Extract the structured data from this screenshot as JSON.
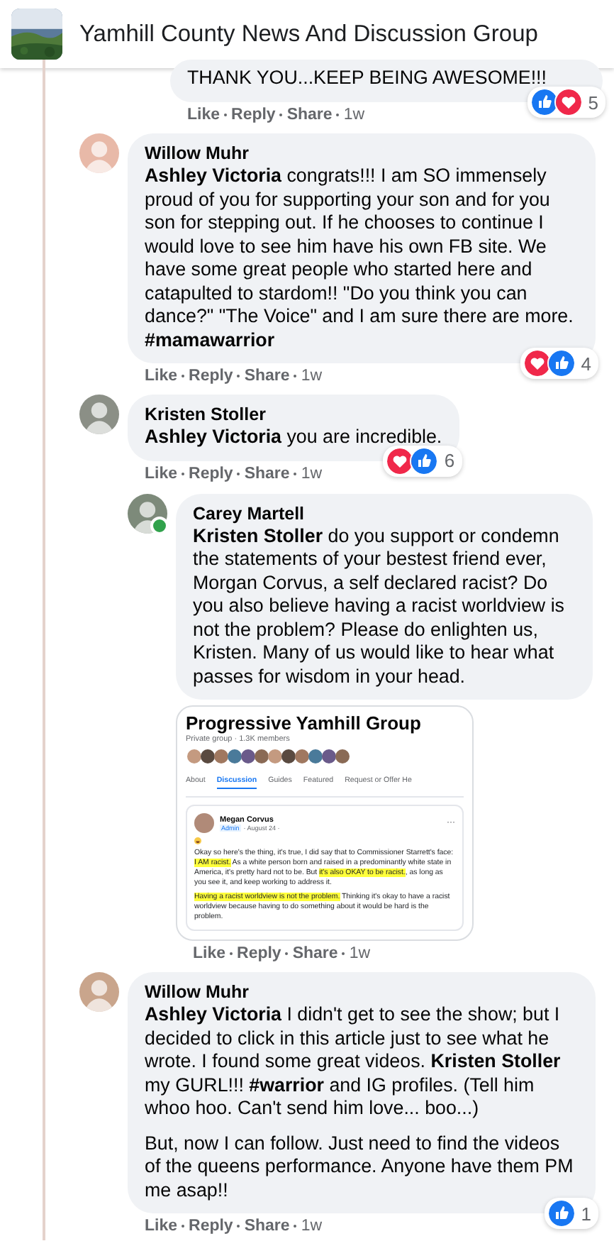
{
  "header": {
    "title": "Yamhill County News And Discussion Group"
  },
  "previous_reply": {
    "text": "THANK YOU...KEEP BEING AWESOME!!!",
    "reactions": [
      {
        "kind": "like"
      },
      {
        "kind": "love"
      }
    ],
    "reaction_count": "5",
    "actions": [
      "Like",
      "Reply",
      "Share",
      "1w"
    ]
  },
  "comments": [
    {
      "author": "Willow Muhr",
      "paragraphs": [
        "**Ashley Victoria** congrats!!! I am SO immensely proud of you for supporting your son and for you son for stepping out. If he chooses to continue I would love to see him have his own FB site. We have some great people who started here and catapulted to stardom!! \"Do you think you can dance?\" \"The Voice\" and I am sure there are more. **#mamawarrior**"
      ],
      "reactions": [
        {
          "kind": "love"
        },
        {
          "kind": "like"
        }
      ],
      "reaction_count": "4",
      "actions": [
        "Like",
        "Reply",
        "Share",
        "1w"
      ]
    },
    {
      "author": "Kristen Stoller",
      "paragraphs": [
        "**Ashley Victoria** you are incredible."
      ],
      "reactions": [
        {
          "kind": "love"
        },
        {
          "kind": "like"
        }
      ],
      "reaction_count": "6",
      "actions": [
        "Like",
        "Reply",
        "Share",
        "1w"
      ],
      "children": [
        {
          "author": "Carey Martell",
          "online": true,
          "paragraphs": [
            "**Kristen Stoller** do you support or condemn the statements of your bestest friend ever, Morgan Corvus, a self declared racist? Do you also believe having a racist worldview is not the problem? Please do enlighten us, Kristen. Many of us would like to hear what passes for wisdom in your head."
          ],
          "attachment": {
            "group_name": "Progressive Yamhill Group",
            "group_meta": "Private group · 1.3K members",
            "tabs": [
              {
                "label": "About",
                "selected": false
              },
              {
                "label": "Discussion",
                "selected": true
              },
              {
                "label": "Guides",
                "selected": false
              },
              {
                "label": "Featured",
                "selected": false
              },
              {
                "label": "Request or Offer He",
                "selected": false
              }
            ],
            "post_author": "Megan Corvus",
            "post_role": "Admin",
            "post_date": "· August 24 ·",
            "post_menu": "···",
            "post_paragraphs": [
              [
                {
                  "text": "Okay so here's the thing, it's true, I did say that to Commissioner Starrett's face: ",
                  "highlight": false
                },
                {
                  "text": "I AM racist.",
                  "highlight": true
                },
                {
                  "text": " As a white person born and raised in a predominantly white state in America, it's pretty hard not to be. But ",
                  "highlight": false
                },
                {
                  "text": "it's also OKAY to be racist.",
                  "highlight": true
                },
                {
                  "text": ", as long as you see it, and keep working to address it.",
                  "highlight": false
                }
              ],
              [
                {
                  "text": "Having a racist worldview is not the problem.",
                  "highlight": true
                },
                {
                  "text": " Thinking it's okay to have a racist worldview because having to do something about it would be hard is the problem.",
                  "highlight": false
                }
              ]
            ]
          },
          "actions": [
            "Like",
            "Reply",
            "Share",
            "1w"
          ]
        }
      ]
    },
    {
      "author": "Willow Muhr",
      "paragraphs": [
        "**Ashley Victoria** I didn't get to see the show; but I decided to click in this article just to see what he wrote. I found some great videos. **Kristen Stoller** my GURL!!! **#warrior** and IG profiles. (Tell him whoo hoo. Can't send him love... boo...)",
        "But, now I can follow. Just need to find the videos of the queens performance. Anyone have them PM me asap!!"
      ],
      "reactions": [
        {
          "kind": "like"
        }
      ],
      "reaction_count": "1",
      "actions": [
        "Like",
        "Reply",
        "Share",
        "1w"
      ]
    }
  ]
}
